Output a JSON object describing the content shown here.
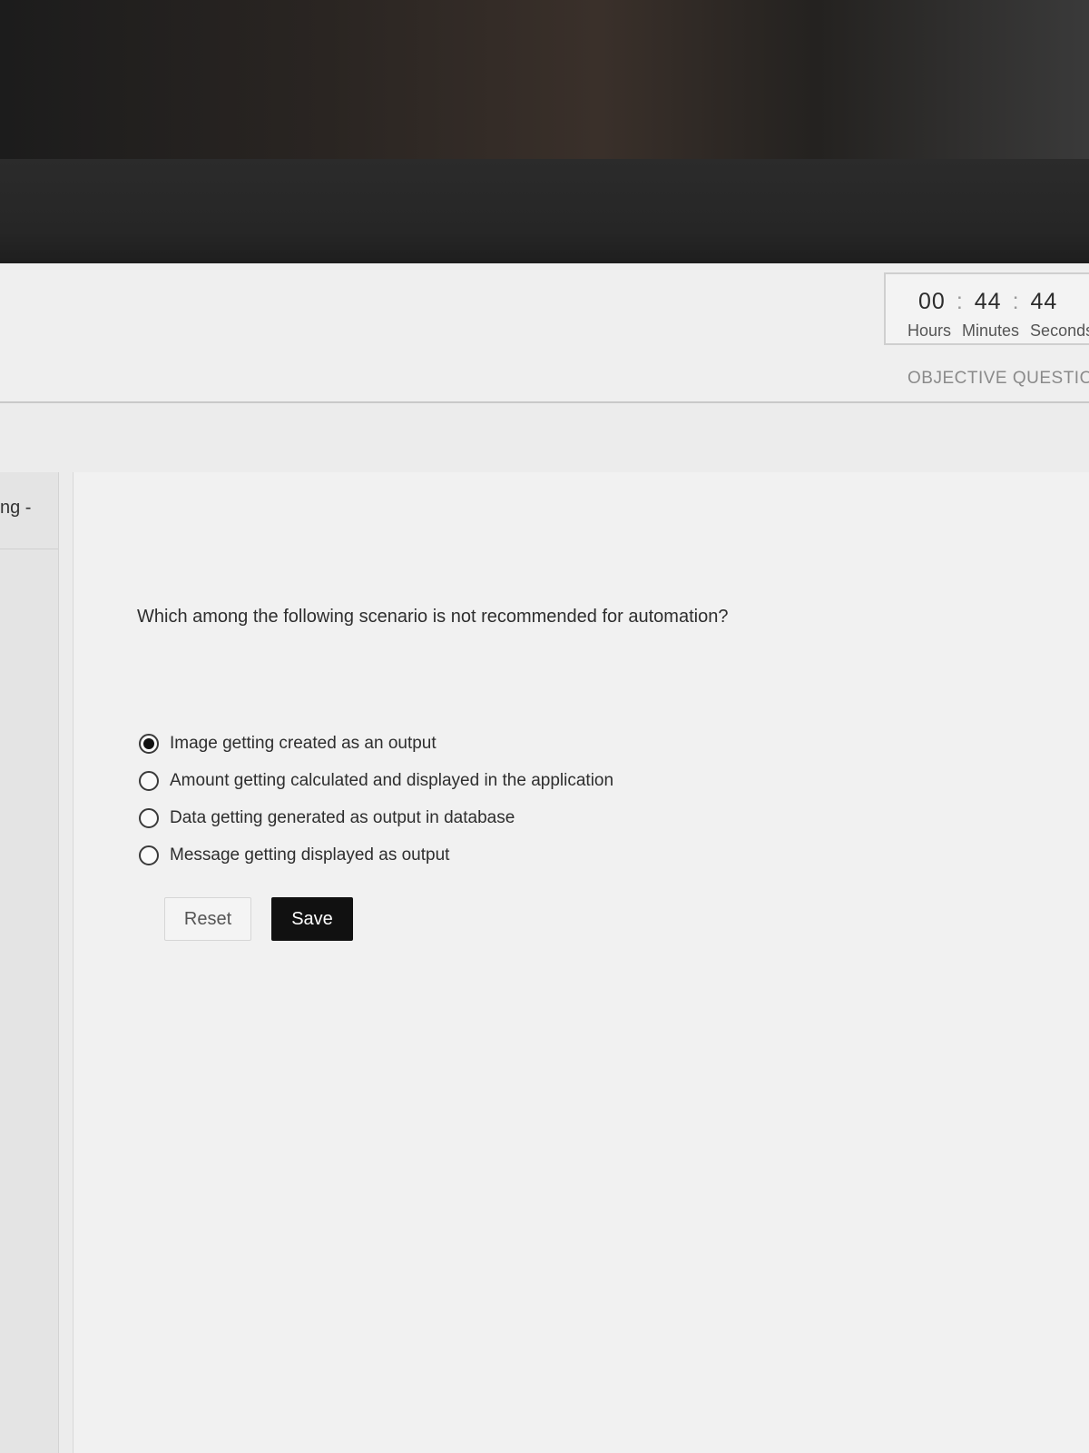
{
  "timer": {
    "hours": "00",
    "minutes": "44",
    "seconds": "44",
    "separator": ":",
    "labels": {
      "hours": "Hours",
      "minutes": "Minutes",
      "seconds": "Seconds"
    }
  },
  "section": {
    "label": "OBJECTIVE QUESTIONS"
  },
  "sidebar": {
    "tab_label": "ng -"
  },
  "question": {
    "text": "Which among the following scenario is not recommended for automation?",
    "options": [
      {
        "label": "Image getting created as an output",
        "selected": true
      },
      {
        "label": "Amount getting calculated and displayed in the application",
        "selected": false
      },
      {
        "label": "Data getting generated as output in database",
        "selected": false
      },
      {
        "label": "Message getting displayed as output",
        "selected": false
      }
    ]
  },
  "actions": {
    "reset_label": "Reset",
    "save_label": "Save"
  },
  "colors": {
    "save_button_bg": "#111111",
    "reset_button_bg": "#f4f4f4",
    "text": "#2e2e2e"
  }
}
